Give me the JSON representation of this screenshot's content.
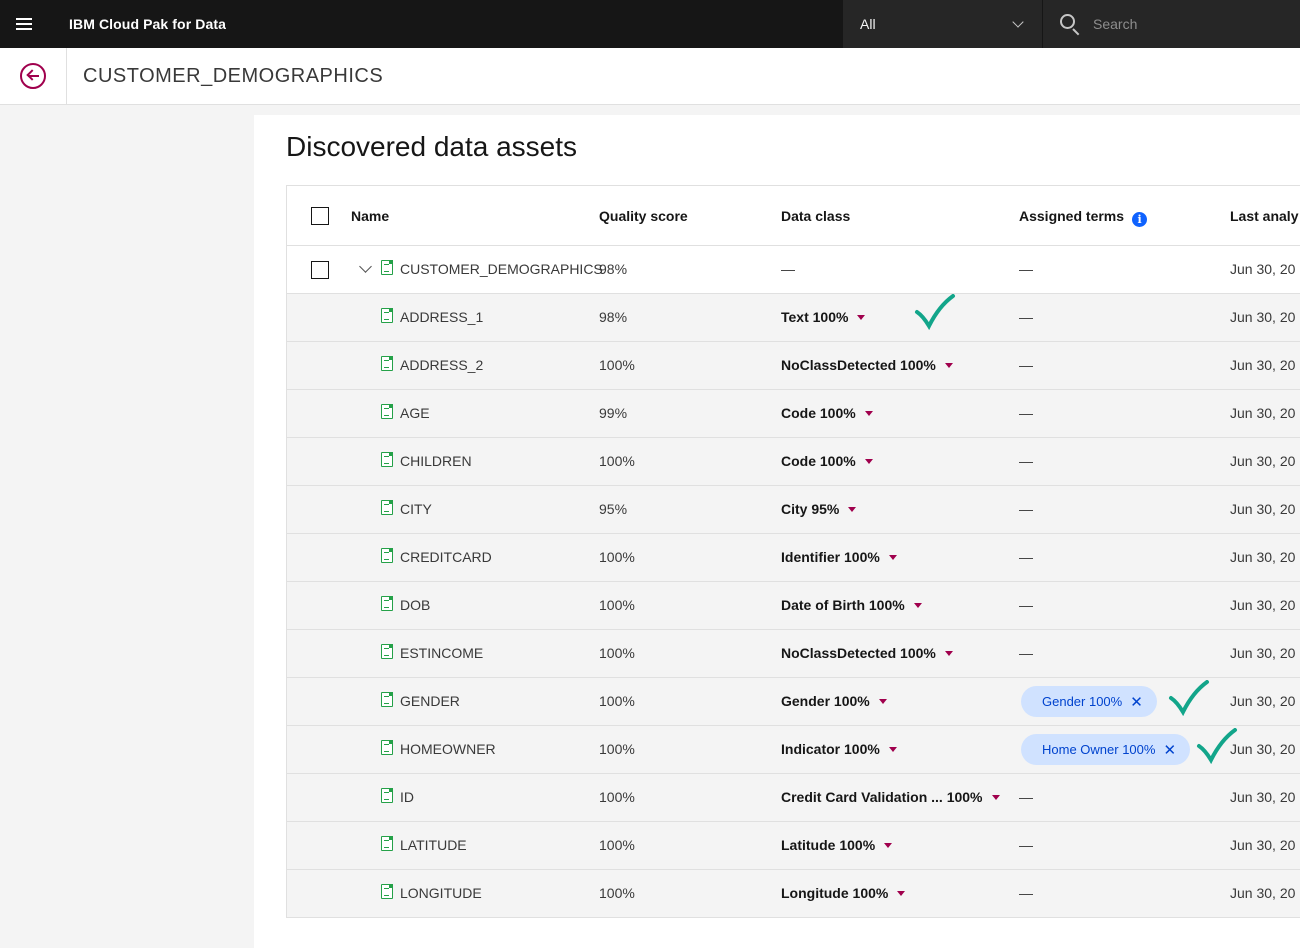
{
  "topbar": {
    "product": "IBM Cloud Pak for Data",
    "scope_value": "All",
    "search_placeholder": "Search"
  },
  "header": {
    "asset_name": "CUSTOMER_DEMOGRAPHICS"
  },
  "main": {
    "section_title": "Discovered data assets"
  },
  "table": {
    "columns": {
      "name": "Name",
      "quality": "Quality score",
      "data_class": "Data class",
      "terms": "Assigned terms",
      "last": "Last analy"
    },
    "parent": {
      "name": "CUSTOMER_DEMOGRAPHICS",
      "quality": "98%",
      "data_class": "—",
      "terms": "—",
      "last": "Jun 30, 20"
    },
    "rows": [
      {
        "name": "ADDRESS_1",
        "quality": "98%",
        "data_class": "Text 100%",
        "terms": "—",
        "last": "Jun 30, 20"
      },
      {
        "name": "ADDRESS_2",
        "quality": "100%",
        "data_class": "NoClassDetected 100%",
        "terms": "—",
        "last": "Jun 30, 20"
      },
      {
        "name": "AGE",
        "quality": "99%",
        "data_class": "Code 100%",
        "terms": "—",
        "last": "Jun 30, 20"
      },
      {
        "name": "CHILDREN",
        "quality": "100%",
        "data_class": "Code 100%",
        "terms": "—",
        "last": "Jun 30, 20"
      },
      {
        "name": "CITY",
        "quality": "95%",
        "data_class": "City 95%",
        "terms": "—",
        "last": "Jun 30, 20"
      },
      {
        "name": "CREDITCARD",
        "quality": "100%",
        "data_class": "Identifier 100%",
        "terms": "—",
        "last": "Jun 30, 20"
      },
      {
        "name": "DOB",
        "quality": "100%",
        "data_class": "Date of Birth 100%",
        "terms": "—",
        "last": "Jun 30, 20"
      },
      {
        "name": "ESTINCOME",
        "quality": "100%",
        "data_class": "NoClassDetected 100%",
        "terms": "—",
        "last": "Jun 30, 20"
      },
      {
        "name": "GENDER",
        "quality": "100%",
        "data_class": "Gender 100%",
        "terms": "",
        "term_tag": "Gender  100%",
        "last": "Jun 30, 20"
      },
      {
        "name": "HOMEOWNER",
        "quality": "100%",
        "data_class": "Indicator 100%",
        "terms": "",
        "term_tag": "Home Owner  100%",
        "last": "Jun 30, 20"
      },
      {
        "name": "ID",
        "quality": "100%",
        "data_class": "Credit Card Validation ...  100%",
        "terms": "—",
        "last": "Jun 30, 20"
      },
      {
        "name": "LATITUDE",
        "quality": "100%",
        "data_class": "Latitude 100%",
        "terms": "—",
        "last": "Jun 30, 20"
      },
      {
        "name": "LONGITUDE",
        "quality": "100%",
        "data_class": "Longitude 100%",
        "terms": "—",
        "last": "Jun 30, 20"
      }
    ]
  },
  "colors": {
    "accent": "#a0004d",
    "tag_bg": "#d0e2ff",
    "check": "#12a58a"
  }
}
